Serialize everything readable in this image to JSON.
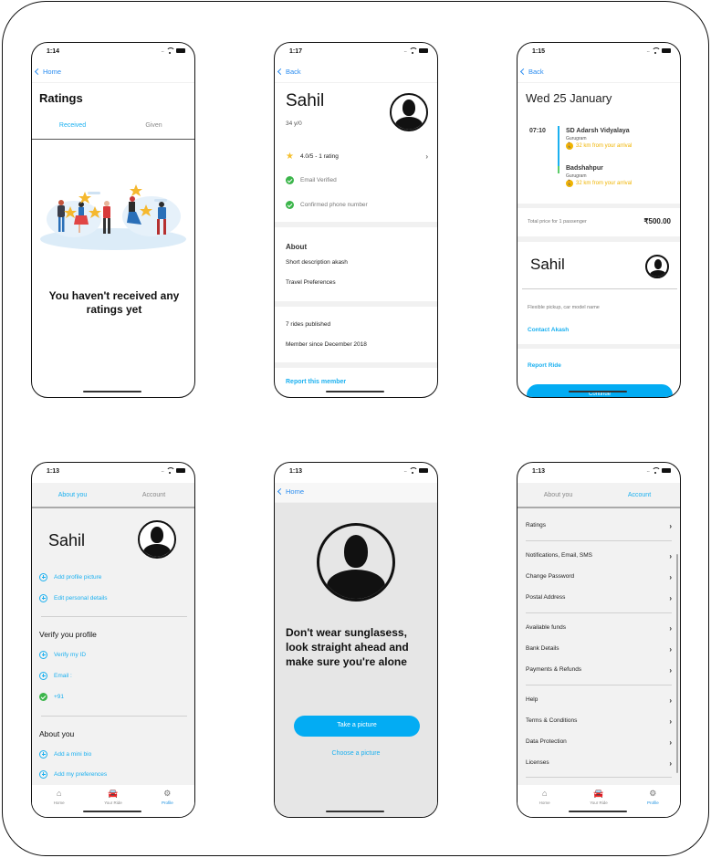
{
  "screens": {
    "ratings": {
      "status_time": "1:14",
      "back_label": "Home",
      "title": "Ratings",
      "tabs": [
        {
          "label": "Received",
          "active": true
        },
        {
          "label": "Given",
          "active": false
        }
      ],
      "illustration": "people-holding-stars-illustration",
      "empty_message": "You haven't received any ratings yet"
    },
    "member_profile": {
      "status_time": "1:17",
      "back_label": "Back",
      "name": "Sahil",
      "age": "34 y/0",
      "rating": "4.0/5 - 1 rating",
      "verifications": [
        "Email Verified",
        "Confirmed phone number"
      ],
      "about_heading": "About",
      "about_items": [
        "Short description akash",
        "Travel Preferences"
      ],
      "stats": [
        "7 rides published",
        "Member since December 2018"
      ],
      "report_link": "Report this member"
    },
    "ride_details": {
      "status_time": "1:15",
      "back_label": "Back",
      "date": "Wed 25 January",
      "departure_time": "07:10",
      "stops": [
        {
          "name": "SD Adarsh Vidyalaya",
          "city": "Gurugram",
          "distance": "32 km from your arrival"
        },
        {
          "name": "Badshahpur",
          "city": "Gurugram",
          "distance": "32 km from your arrival"
        }
      ],
      "price_label": "Total price for 1 passenger",
      "price": "₹500.00",
      "driver_name": "Sahil",
      "note": "Flexible pickup, car model name",
      "contact_link": "Contact Akash",
      "report_link": "Report Ride",
      "continue_label": "Continue"
    },
    "profile_about": {
      "status_time": "1:13",
      "segments": [
        {
          "label": "About you",
          "active": true
        },
        {
          "label": "Account",
          "active": false
        }
      ],
      "name": "Sahil",
      "actions": [
        "Add profile picture",
        "Edit personal details"
      ],
      "verify_heading": "Verify you profile",
      "verify_items": [
        {
          "label": "Verify my ID",
          "icon": "plus-circle-icon"
        },
        {
          "label": "Email :",
          "icon": "plus-circle-icon"
        },
        {
          "label": "+91",
          "icon": "check-circle-icon"
        }
      ],
      "about_heading": "About you",
      "about_items": [
        "Add a mini bio",
        "Add my preferences"
      ]
    },
    "photo_capture": {
      "status_time": "1:13",
      "back_label": "Home",
      "instruction": "Don't wear sunglasess, look straight ahead and make sure you're alone",
      "take_label": "Take a picture",
      "choose_label": "Choose a picture"
    },
    "profile_account": {
      "status_time": "1:13",
      "segments": [
        {
          "label": "About you",
          "active": false
        },
        {
          "label": "Account",
          "active": true
        }
      ],
      "groups": [
        [
          "Ratings"
        ],
        [
          "Notifications, Email, SMS",
          "Change Password",
          "Postal Address"
        ],
        [
          "Available funds",
          "Bank Details",
          "Payments & Refunds"
        ],
        [
          "Help",
          "Terms & Conditions",
          "Data Protection",
          "Licenses"
        ]
      ]
    }
  },
  "tabbar": [
    {
      "label": "Home",
      "icon": "home-icon"
    },
    {
      "label": "Your Ride",
      "icon": "car-icon"
    },
    {
      "label": "Profile",
      "icon": "gear-icon",
      "active": true
    }
  ],
  "colors": {
    "accent": "#1ab0f0",
    "button": "#03acf3",
    "ios_link": "#2a8cf0",
    "success": "#3bb54a",
    "warning": "#f0b400"
  }
}
